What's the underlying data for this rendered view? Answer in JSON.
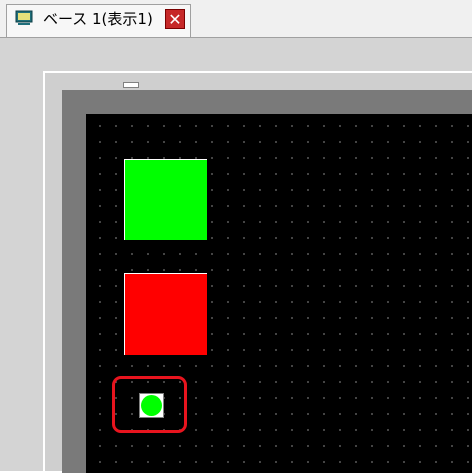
{
  "tab": {
    "label": "ベース 1(表示1)",
    "icon": "screen-icon",
    "close_icon": "close-icon",
    "close_label": "✕"
  },
  "canvas": {
    "background": "#000000",
    "grid": true
  },
  "parts": [
    {
      "name": "green-switch",
      "color": "#00ff00"
    },
    {
      "name": "red-switch",
      "color": "#ff0000"
    },
    {
      "name": "lamp",
      "color": "#00ff00",
      "highlighted": true
    }
  ],
  "colors": {
    "highlight": "#e8141e",
    "close_button": "#c62828"
  }
}
